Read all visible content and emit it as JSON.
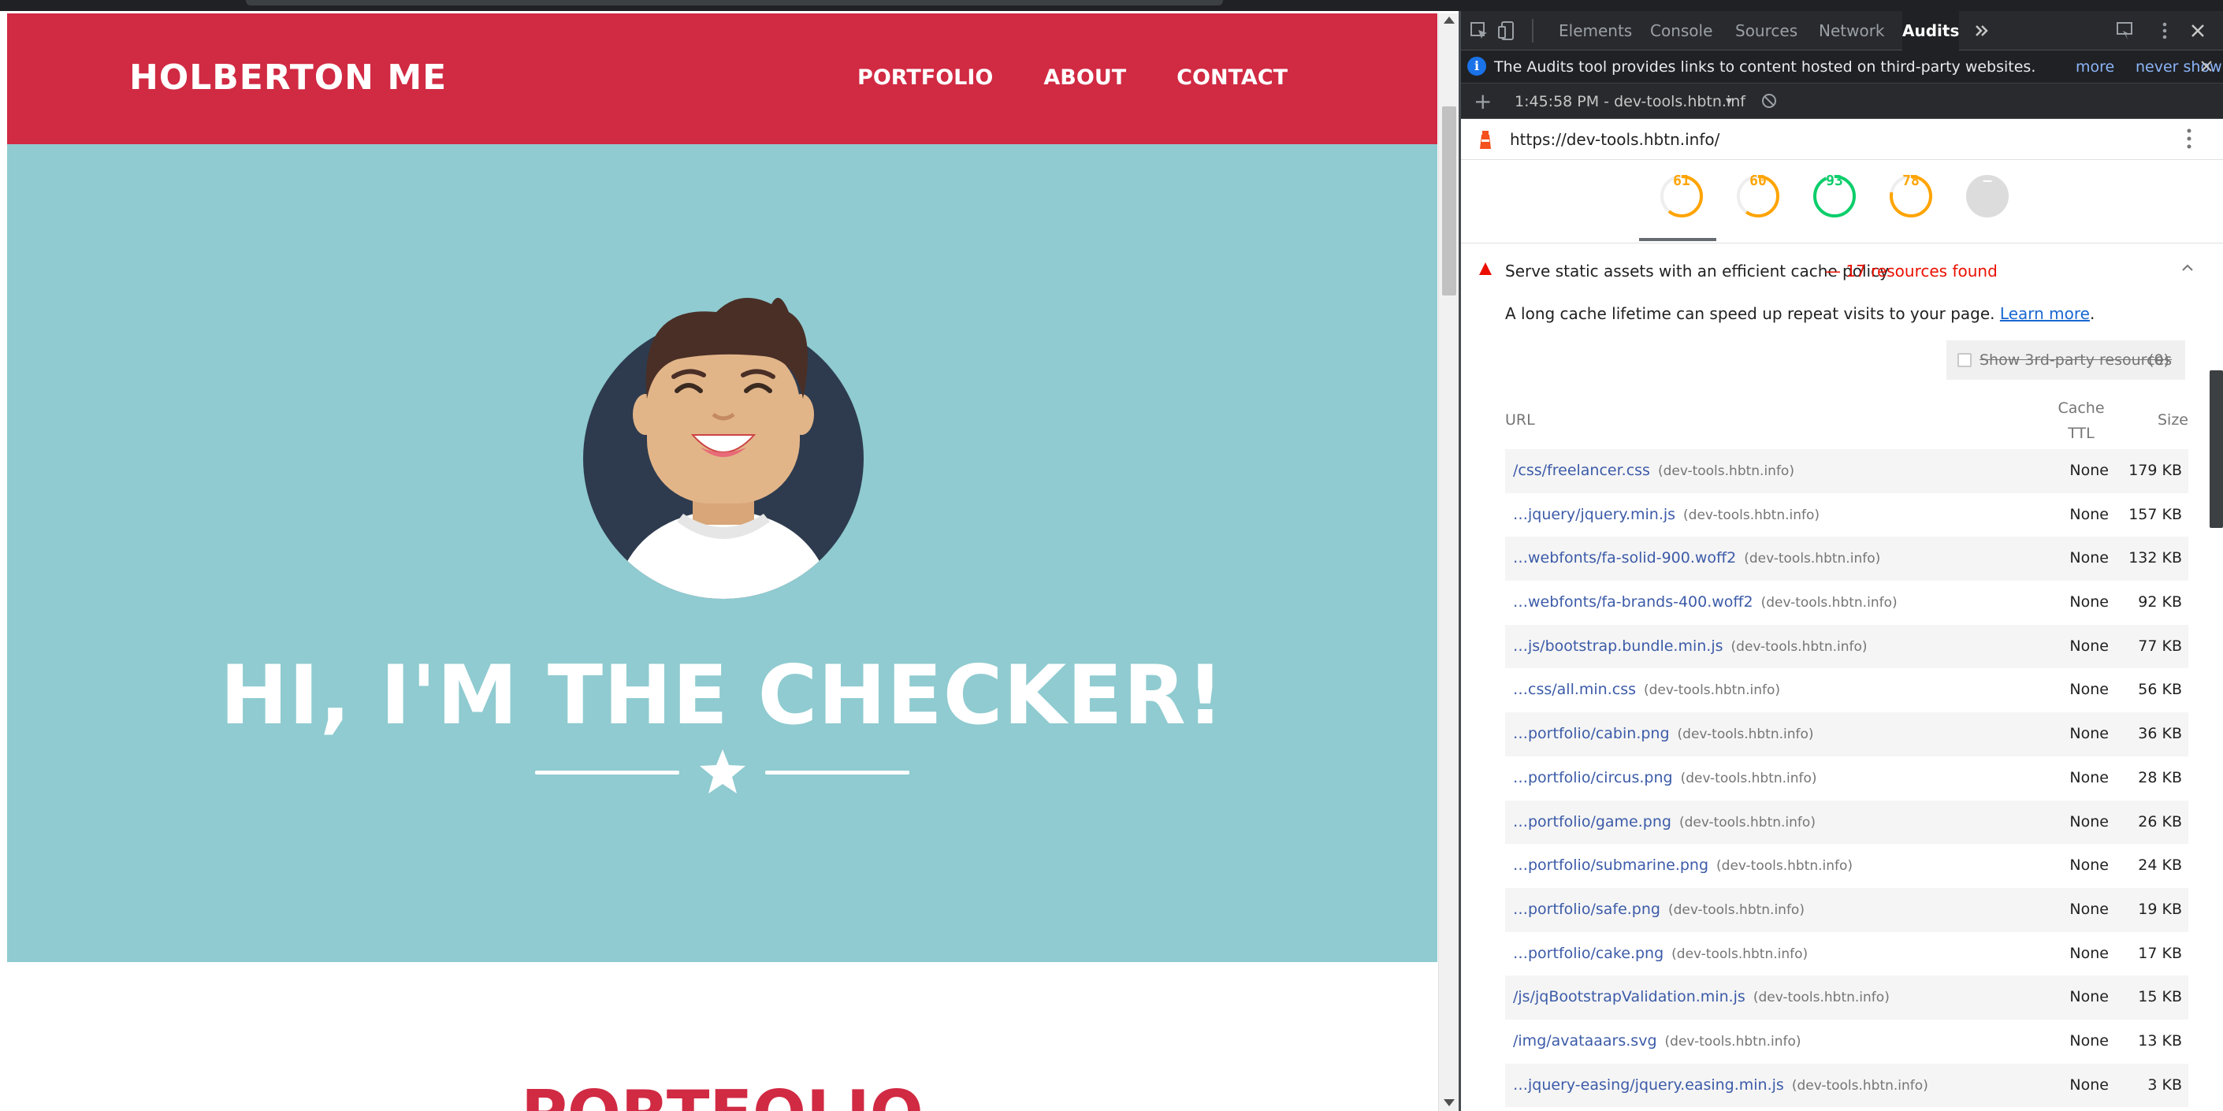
{
  "page": {
    "brand": "HOLBERTON ME",
    "nav": [
      "PORTFOLIO",
      "ABOUT",
      "CONTACT"
    ],
    "hero_title": "HI, I'M THE CHECKER!",
    "section_title": "PORTFOLIO",
    "colors": {
      "nav": "#d12a43",
      "hero": "#8fcbd0"
    }
  },
  "devtools": {
    "tabs": [
      "Elements",
      "Console",
      "Sources",
      "Network",
      "Audits"
    ],
    "active_tab": "Audits",
    "notice": {
      "text": "The Audits tool provides links to content hosted on third-party websites.",
      "more": "more",
      "never_show": "never show"
    },
    "run_label": "1:45:58 PM - dev-tools.hbtn.inf",
    "url": "https://dev-tools.hbtn.info/",
    "scores": [
      {
        "label": "61",
        "color": "#ffa400",
        "fraction": 0.61
      },
      {
        "label": "60",
        "color": "#ffa400",
        "fraction": 0.6
      },
      {
        "label": "93",
        "color": "#0cce6b",
        "fraction": 0.93
      },
      {
        "label": "78",
        "color": "#ffa400",
        "fraction": 0.78
      },
      {
        "label": "–",
        "color": "#bdbdbd",
        "fraction": 0
      }
    ],
    "audit": {
      "title": "Serve static assets with an efficient cache policy",
      "found": "— 17 resources found",
      "description": "A long cache lifetime can speed up repeat visits to your page.",
      "learn_more": "Learn more",
      "third_party_label": "Show 3rd-party resources",
      "third_party_count": "(0)",
      "columns": {
        "url": "URL",
        "ttl_line1": "Cache",
        "ttl_line2": "TTL",
        "size": "Size"
      },
      "rows": [
        {
          "url": "/css/freelancer.css",
          "host": "(dev-tools.hbtn.info)",
          "ttl": "None",
          "size": "179 KB"
        },
        {
          "url": "…jquery/jquery.min.js",
          "host": "(dev-tools.hbtn.info)",
          "ttl": "None",
          "size": "157 KB"
        },
        {
          "url": "…webfonts/fa-solid-900.woff2",
          "host": "(dev-tools.hbtn.info)",
          "ttl": "None",
          "size": "132 KB"
        },
        {
          "url": "…webfonts/fa-brands-400.woff2",
          "host": "(dev-tools.hbtn.info)",
          "ttl": "None",
          "size": "92 KB"
        },
        {
          "url": "…js/bootstrap.bundle.min.js",
          "host": "(dev-tools.hbtn.info)",
          "ttl": "None",
          "size": "77 KB"
        },
        {
          "url": "…css/all.min.css",
          "host": "(dev-tools.hbtn.info)",
          "ttl": "None",
          "size": "56 KB"
        },
        {
          "url": "…portfolio/cabin.png",
          "host": "(dev-tools.hbtn.info)",
          "ttl": "None",
          "size": "36 KB"
        },
        {
          "url": "…portfolio/circus.png",
          "host": "(dev-tools.hbtn.info)",
          "ttl": "None",
          "size": "28 KB"
        },
        {
          "url": "…portfolio/game.png",
          "host": "(dev-tools.hbtn.info)",
          "ttl": "None",
          "size": "26 KB"
        },
        {
          "url": "…portfolio/submarine.png",
          "host": "(dev-tools.hbtn.info)",
          "ttl": "None",
          "size": "24 KB"
        },
        {
          "url": "…portfolio/safe.png",
          "host": "(dev-tools.hbtn.info)",
          "ttl": "None",
          "size": "19 KB"
        },
        {
          "url": "…portfolio/cake.png",
          "host": "(dev-tools.hbtn.info)",
          "ttl": "None",
          "size": "17 KB"
        },
        {
          "url": "/js/jqBootstrapValidation.min.js",
          "host": "(dev-tools.hbtn.info)",
          "ttl": "None",
          "size": "15 KB"
        },
        {
          "url": "/img/avataaars.svg",
          "host": "(dev-tools.hbtn.info)",
          "ttl": "None",
          "size": "13 KB"
        },
        {
          "url": "…jquery-easing/jquery.easing.min.js",
          "host": "(dev-tools.hbtn.info)",
          "ttl": "None",
          "size": "3 KB"
        }
      ]
    }
  }
}
